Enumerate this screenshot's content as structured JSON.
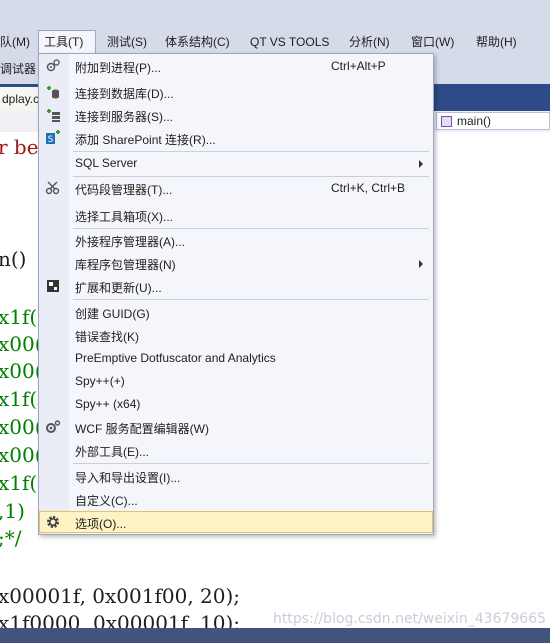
{
  "menubar": {
    "items": [
      {
        "label": "队(M)"
      },
      {
        "label": "工具(T)"
      },
      {
        "label": "测试(S)"
      },
      {
        "label": "体系结构(C)"
      },
      {
        "label": "QT VS TOOLS"
      },
      {
        "label": "分析(N)"
      },
      {
        "label": "窗口(W)"
      },
      {
        "label": "帮助(H)"
      }
    ]
  },
  "toolbar": {
    "debugger_label": "调试器"
  },
  "editor_tab": {
    "label": "dplay.c"
  },
  "navbar": {
    "function_combo": "main()"
  },
  "code_lines": [
    "r be",
    "n()",
    "x1f(",
    "x00(",
    "x00(",
    "x1f(",
    "x00(",
    "x00(",
    "x1f(",
    ",1)",
    ";*/",
    "x00001f, 0x001f00, 20);",
    "x1f0000, 0x00001f, 10);"
  ],
  "tools_menu": {
    "items": [
      {
        "label": "附加到进程(P)...",
        "shortcut": "Ctrl+Alt+P",
        "icon": "attach-process-icon"
      },
      {
        "label": "连接到数据库(D)...",
        "shortcut": "",
        "icon": "connect-database-icon"
      },
      {
        "label": "连接到服务器(S)...",
        "shortcut": "",
        "icon": "connect-server-icon"
      },
      {
        "label": "添加 SharePoint 连接(R)...",
        "shortcut": "",
        "icon": "sharepoint-icon"
      },
      {
        "label": "SQL Server",
        "shortcut": "",
        "icon": "",
        "submenu": true
      },
      {
        "label": "代码段管理器(T)...",
        "shortcut": "Ctrl+K, Ctrl+B",
        "icon": "snippet-manager-icon"
      },
      {
        "label": "选择工具箱项(X)...",
        "shortcut": "",
        "icon": ""
      },
      {
        "label": "外接程序管理器(A)...",
        "shortcut": "",
        "icon": ""
      },
      {
        "label": "库程序包管理器(N)",
        "shortcut": "",
        "icon": "",
        "submenu": true
      },
      {
        "label": "扩展和更新(U)...",
        "shortcut": "",
        "icon": "extensions-icon"
      },
      {
        "label": "创建 GUID(G)",
        "shortcut": "",
        "icon": ""
      },
      {
        "label": "错误查找(K)",
        "shortcut": "",
        "icon": ""
      },
      {
        "label": "PreEmptive Dotfuscator and Analytics",
        "shortcut": "",
        "icon": ""
      },
      {
        "label": "Spy++(+)",
        "shortcut": "",
        "icon": ""
      },
      {
        "label": "Spy++ (x64)",
        "shortcut": "",
        "icon": ""
      },
      {
        "label": "WCF 服务配置编辑器(W)",
        "shortcut": "",
        "icon": "wcf-config-icon"
      },
      {
        "label": "外部工具(E)...",
        "shortcut": "",
        "icon": ""
      },
      {
        "label": "导入和导出设置(I)...",
        "shortcut": "",
        "icon": ""
      },
      {
        "label": "自定义(C)...",
        "shortcut": "",
        "icon": ""
      },
      {
        "label": "选项(O)...",
        "shortcut": "",
        "icon": "gear-icon",
        "highlighted": true
      }
    ]
  },
  "watermark": "https://blog.csdn.net/weixin_43679665",
  "colors": {
    "chrome": "#d6dbe9",
    "tab_strip": "#2f4a88",
    "menu_bg": "#f5f6fb",
    "highlight": "#fdf3c5",
    "code_red": "#a31515",
    "code_green": "#008000"
  }
}
